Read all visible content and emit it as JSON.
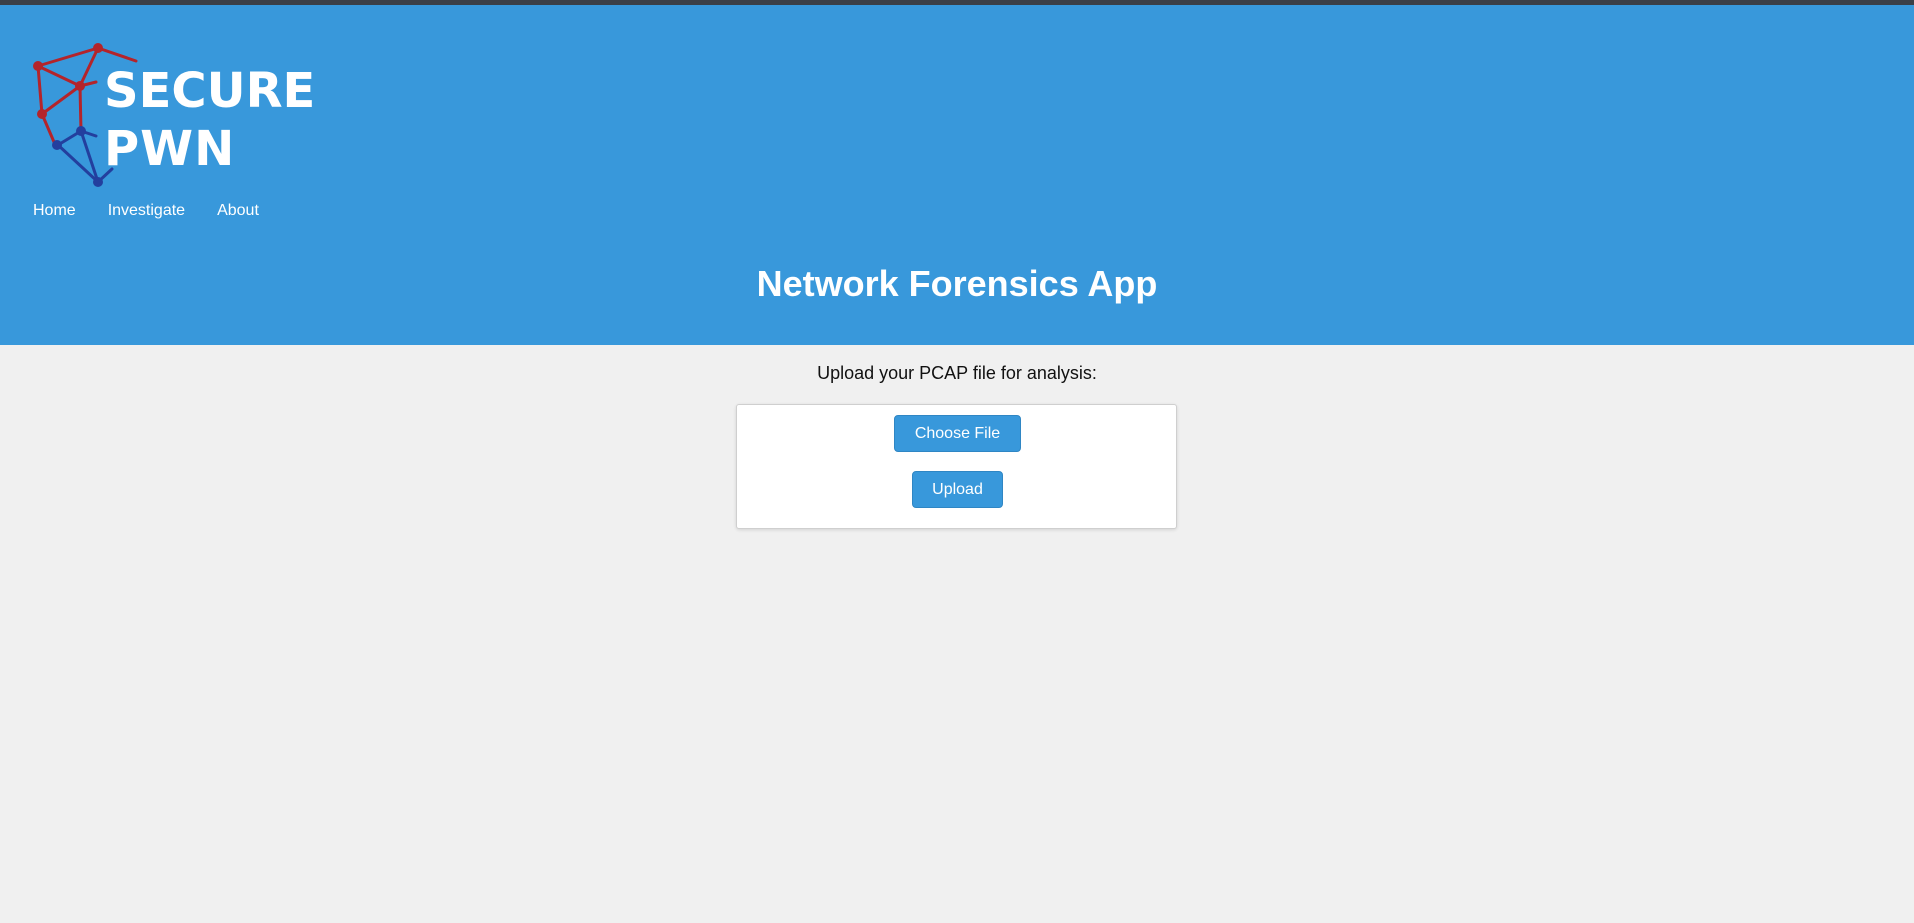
{
  "brand": {
    "logo_icon": "network-shield-icon",
    "logo_text_line1": "SECURE",
    "logo_text_line2": "PWN",
    "colors": {
      "red": "#b4242b",
      "blue": "#233f9e",
      "header": "#3898db"
    }
  },
  "nav": {
    "items": [
      {
        "label": "Home"
      },
      {
        "label": "Investigate"
      },
      {
        "label": "About"
      }
    ]
  },
  "header": {
    "title": "Network Forensics App"
  },
  "upload": {
    "prompt": "Upload your PCAP file for analysis:",
    "choose_label": "Choose File",
    "upload_label": "Upload"
  }
}
